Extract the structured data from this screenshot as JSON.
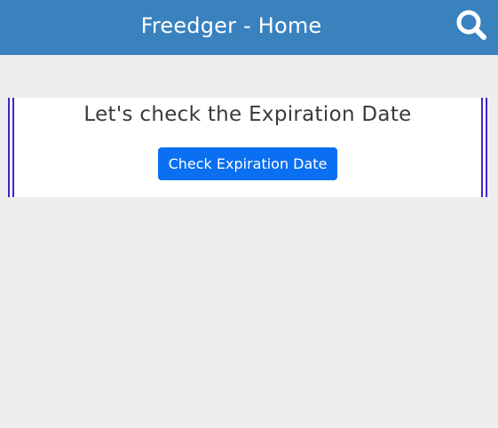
{
  "header": {
    "title": "Freedger - Home",
    "search_icon": "search-icon",
    "background_color": "#3a82be"
  },
  "main": {
    "heading": "Let's check the Expiration Date",
    "check_button_label": "Check Expiration Date",
    "accent_color": "#4422c8",
    "button_color": "#0a6ff0"
  }
}
